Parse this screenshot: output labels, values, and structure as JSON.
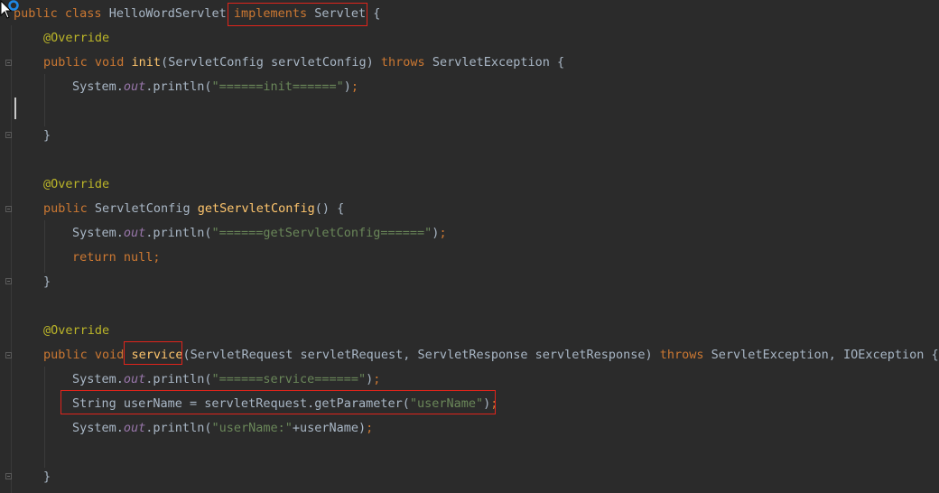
{
  "editor": {
    "lines": [
      {
        "id": "l1",
        "parts": [
          [
            "kw",
            "public "
          ],
          [
            "kw",
            "class "
          ],
          [
            "plain",
            "HelloWordServlet "
          ],
          [
            "kw",
            "implements "
          ],
          [
            "plain",
            "Servlet "
          ],
          [
            "plain",
            "{"
          ]
        ]
      },
      {
        "id": "l2",
        "parts": [
          [
            "ann",
            "@Override"
          ]
        ]
      },
      {
        "id": "l3",
        "parts": [
          [
            "kw",
            "public "
          ],
          [
            "kw",
            "void "
          ],
          [
            "fn",
            "init"
          ],
          [
            "plain",
            "(ServletConfig servletConfig) "
          ],
          [
            "kw",
            "throws "
          ],
          [
            "plain",
            "ServletException {"
          ]
        ]
      },
      {
        "id": "l4",
        "parts": [
          [
            "plain",
            "System."
          ],
          [
            "fld",
            "out"
          ],
          [
            "plain",
            ".println("
          ],
          [
            "str",
            "\"======init======\""
          ],
          [
            "plain",
            ")"
          ],
          [
            "kw",
            ";"
          ]
        ]
      },
      {
        "id": "l5",
        "parts": []
      },
      {
        "id": "l6",
        "parts": [
          [
            "plain",
            "}"
          ]
        ]
      },
      {
        "id": "l7",
        "parts": []
      },
      {
        "id": "l8",
        "parts": [
          [
            "ann",
            "@Override"
          ]
        ]
      },
      {
        "id": "l9",
        "parts": [
          [
            "kw",
            "public "
          ],
          [
            "plain",
            "ServletConfig "
          ],
          [
            "fn",
            "getServletConfig"
          ],
          [
            "plain",
            "() {"
          ]
        ]
      },
      {
        "id": "l10",
        "parts": [
          [
            "plain",
            "System."
          ],
          [
            "fld",
            "out"
          ],
          [
            "plain",
            ".println("
          ],
          [
            "str",
            "\"======getServletConfig======\""
          ],
          [
            "plain",
            ")"
          ],
          [
            "kw",
            ";"
          ]
        ]
      },
      {
        "id": "l11",
        "parts": [
          [
            "kw",
            "return "
          ],
          [
            "kw",
            "null"
          ],
          [
            "kw",
            ";"
          ]
        ]
      },
      {
        "id": "l12",
        "parts": [
          [
            "plain",
            "}"
          ]
        ]
      },
      {
        "id": "l13",
        "parts": []
      },
      {
        "id": "l14",
        "parts": [
          [
            "ann",
            "@Override"
          ]
        ]
      },
      {
        "id": "l15",
        "parts": [
          [
            "kw",
            "public "
          ],
          [
            "kw",
            "void "
          ],
          [
            "fn",
            "service"
          ],
          [
            "plain",
            "(ServletRequest servletRequest, ServletResponse servletResponse) "
          ],
          [
            "kw",
            "throws "
          ],
          [
            "plain",
            "ServletException, IOException {"
          ]
        ]
      },
      {
        "id": "l16",
        "parts": [
          [
            "plain",
            "System."
          ],
          [
            "fld",
            "out"
          ],
          [
            "plain",
            ".println("
          ],
          [
            "str",
            "\"======service======\""
          ],
          [
            "plain",
            ")"
          ],
          [
            "kw",
            ";"
          ]
        ]
      },
      {
        "id": "l17",
        "parts": [
          [
            "plain",
            "String userName = servletRequest.getParameter("
          ],
          [
            "str",
            "\"userName\""
          ],
          [
            "plain",
            ")"
          ],
          [
            "kw",
            ";"
          ]
        ]
      },
      {
        "id": "l18",
        "parts": [
          [
            "plain",
            "System."
          ],
          [
            "fld",
            "out"
          ],
          [
            "plain",
            ".println("
          ],
          [
            "str",
            "\"userName:\""
          ],
          [
            "plain",
            "+userName)"
          ],
          [
            "kw",
            ";"
          ]
        ]
      },
      {
        "id": "l19",
        "parts": []
      },
      {
        "id": "l20",
        "parts": [
          [
            "plain",
            "}"
          ]
        ]
      }
    ]
  }
}
